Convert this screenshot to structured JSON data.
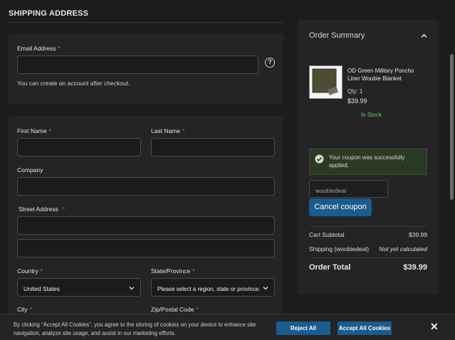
{
  "shipping": {
    "title": "SHIPPING ADDRESS",
    "email_label": "Email Address",
    "required_mark": "*",
    "help_label": "?",
    "email_hint": "You can create an account after checkout.",
    "first_name_label": "First Name",
    "last_name_label": "Last Name",
    "company_label": "Company",
    "street_label": "Street Address",
    "country_label": "Country",
    "country_value": "United States",
    "state_label": "State/Province",
    "state_value": "Please select a region, state or province.",
    "city_label": "City",
    "zip_label": "Zip/Postal Code"
  },
  "summary": {
    "title": "Order Summary",
    "product_name": "OD Green Military Poncho Liner Woobie Blanket",
    "qty": "Qty: 1",
    "price": "$39.99",
    "stock": "In Stock",
    "coupon_success": "Your coupon was successfully applied.",
    "coupon_code": "woobiedeal",
    "cancel_coupon": "Cancel coupon",
    "subtotal_label": "Cart Subtotal",
    "subtotal_value": "$39.99",
    "shipping_label": "Shipping (woobiedeal)",
    "shipping_value": "Not yet calculated",
    "total_label": "Order Total",
    "total_value": "$39.99"
  },
  "cookie": {
    "text": "By clicking “Accept All Cookies”, you agree to the storing of cookies on your device to enhance site navigation, analyze site usage, and assist in our marketing efforts.",
    "reject": "Reject All",
    "accept": "Accept All Cookies",
    "close": "✕"
  },
  "icons": {
    "help": "help-circle-icon",
    "chevron": "chevron-down-icon",
    "collapse": "chevron-up-icon",
    "check": "check-circle-icon",
    "close": "close-icon"
  },
  "colors": {
    "background": "#1c1c1d",
    "panel": "#242426",
    "accent": "#1a5c8d",
    "stock": "#66d36e",
    "required": "#c96b6b"
  }
}
